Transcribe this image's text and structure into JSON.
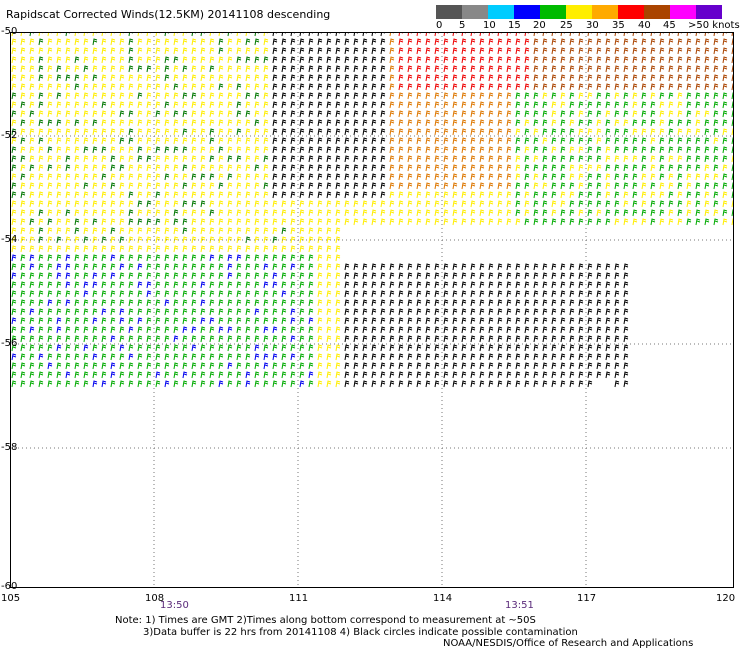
{
  "title": "Rapidscat Corrected Winds(12.5KM) 20141108 descending",
  "legend": {
    "labels": [
      "0",
      "5",
      "10",
      "15",
      "20",
      "25",
      "30",
      "35",
      "40",
      "45",
      ">50 knots"
    ],
    "colors": [
      "#555555",
      "#888888",
      "#00ccff",
      "#0000ff",
      "#00bb00",
      "#ffee00",
      "#ffaa00",
      "#ff0000",
      "#aa4400",
      "#ff00ff",
      "#6600cc"
    ]
  },
  "map": {
    "lat_labels": [
      "-50",
      "-52",
      "-54",
      "-56",
      "-58",
      "-60"
    ],
    "lon_labels": [
      "105",
      "108",
      "111",
      "114",
      "117",
      "120"
    ],
    "times": [
      "13:50",
      "13:51"
    ]
  },
  "notes": {
    "line1": "Note: 1) Times are GMT 2)Times along bottom correspond to measurement at ~50S",
    "line2": "3)Data buffer is 22 hrs from 20141108 4) Black circles indicate possible contamination",
    "credit": "NOAA/NESDIS/Office of Research and Applications"
  }
}
